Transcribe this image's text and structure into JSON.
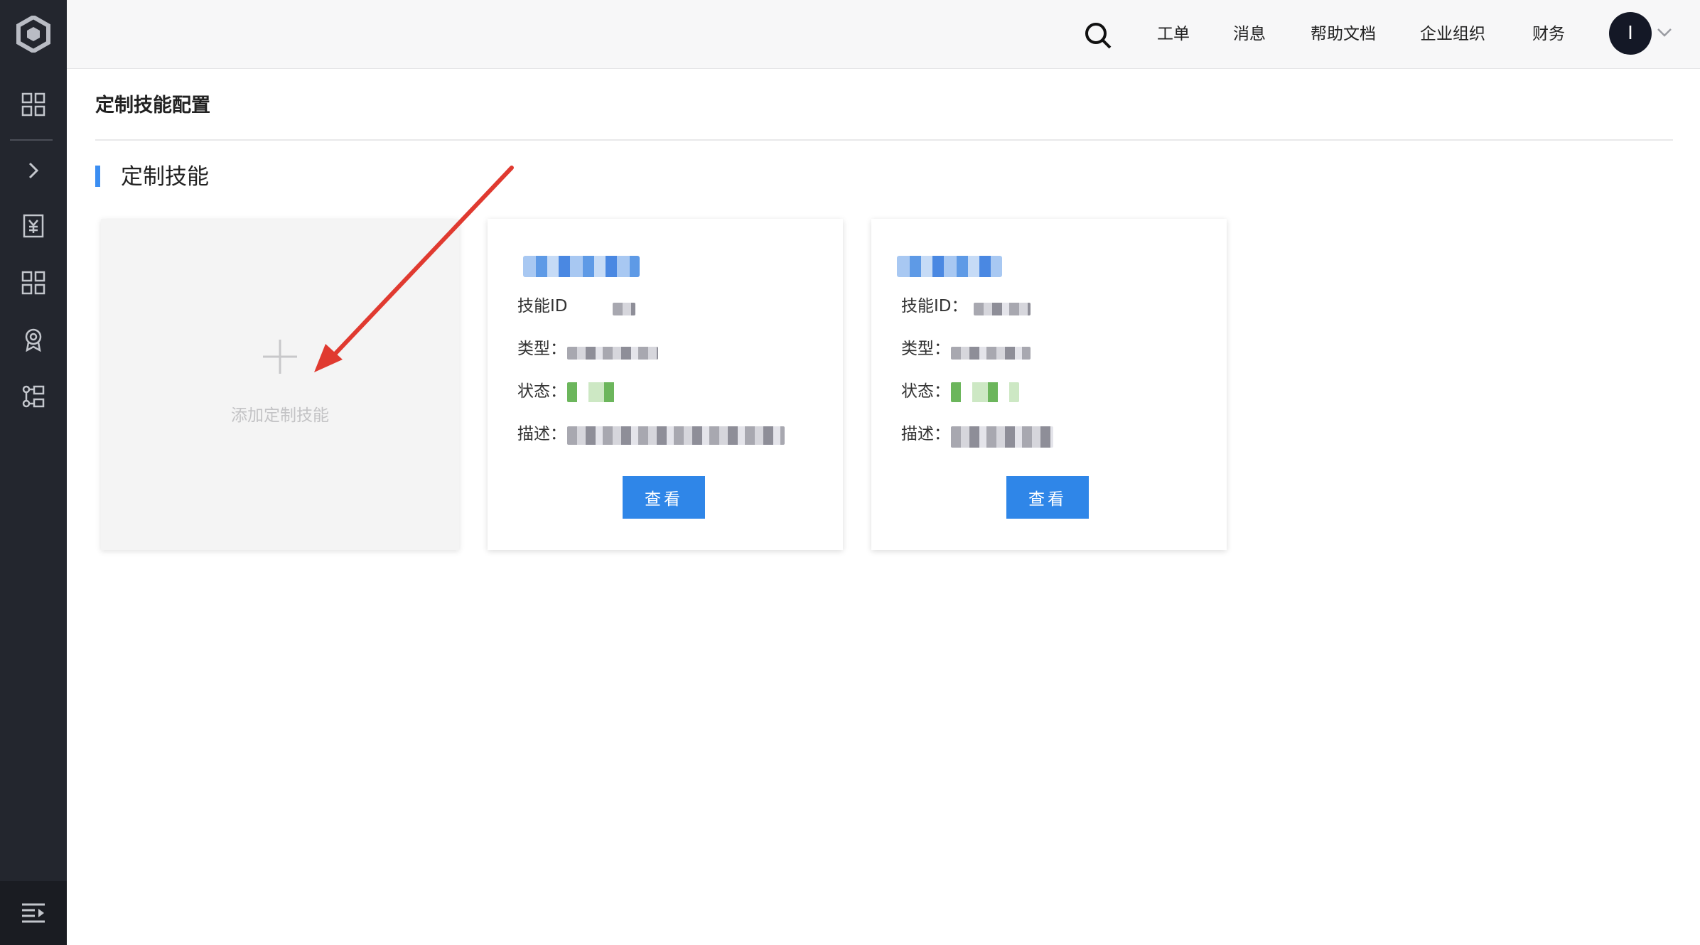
{
  "sidebar": {
    "logo_icon": "cube-logo-icon",
    "items": [
      {
        "icon": "grid-icon"
      },
      {
        "icon": "chevron-right-icon"
      },
      {
        "icon": "billing-icon"
      },
      {
        "icon": "apps-grid-icon"
      },
      {
        "icon": "badge-icon"
      },
      {
        "icon": "structure-icon"
      }
    ],
    "bottom_icon": "menu-collapse-icon"
  },
  "topbar": {
    "search_icon": "search-icon",
    "nav": [
      "工单",
      "消息",
      "帮助文档",
      "企业组织",
      "财务"
    ],
    "avatar_initial": "I",
    "avatar_caret_icon": "chevron-down-icon"
  },
  "page": {
    "title": "定制技能配置",
    "section_title": "定制技能"
  },
  "add_card": {
    "label": "添加定制技能",
    "icon": "plus-icon"
  },
  "skill_cards": [
    {
      "id_label": "技能ID",
      "type_label": "类型：",
      "status_label": "状态：",
      "desc_label": "描述：",
      "button_label": "查看"
    },
    {
      "id_label": "技能ID：",
      "type_label": "类型：",
      "status_label": "状态：",
      "desc_label": "描述：",
      "button_label": "查看"
    }
  ],
  "colors": {
    "sidebar_bg": "#23262e",
    "accent": "#3b8ef2",
    "button": "#2f86e8",
    "annotation_arrow": "#e03a30"
  }
}
